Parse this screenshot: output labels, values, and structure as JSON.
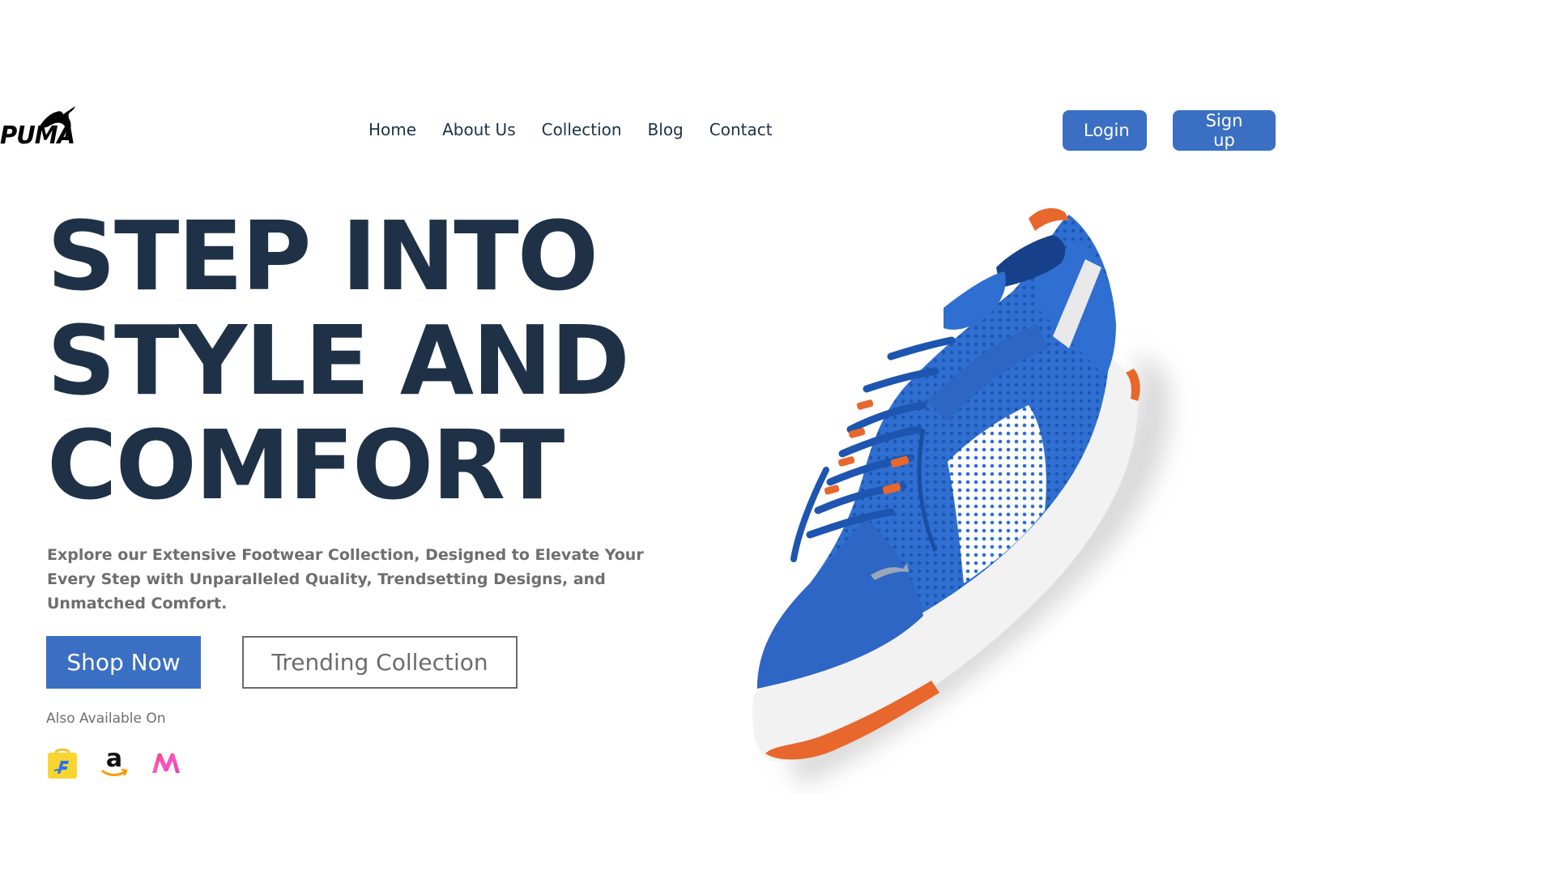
{
  "brand": {
    "logo_text": "PUMA"
  },
  "nav": {
    "items": [
      {
        "label": "Home"
      },
      {
        "label": "About Us"
      },
      {
        "label": "Collection"
      },
      {
        "label": "Blog"
      },
      {
        "label": "Contact"
      }
    ]
  },
  "auth": {
    "login_label": "Login",
    "signup_label": "Sign up"
  },
  "hero": {
    "title_lines": [
      "STEP INTO",
      "STYLE AND",
      "COMFORT"
    ],
    "description": "Explore our Extensive Footwear Collection, Designed to Elevate Your Every Step with Unparalleled Quality, Trendsetting Designs, and Unmatched Comfort.",
    "shop_button": "Shop Now",
    "trending_button": "Trending Collection",
    "also_available_label": "Also Available On",
    "stores": [
      {
        "icon": "flipkart-icon"
      },
      {
        "icon": "amazon-icon"
      },
      {
        "icon": "myntra-icon"
      }
    ]
  },
  "colors": {
    "accent": "#3a6fc4",
    "heading": "#1f3147",
    "body_text": "#6e6e6e",
    "shoe_blue": "#2f6fd1",
    "shoe_orange": "#e8672d"
  }
}
